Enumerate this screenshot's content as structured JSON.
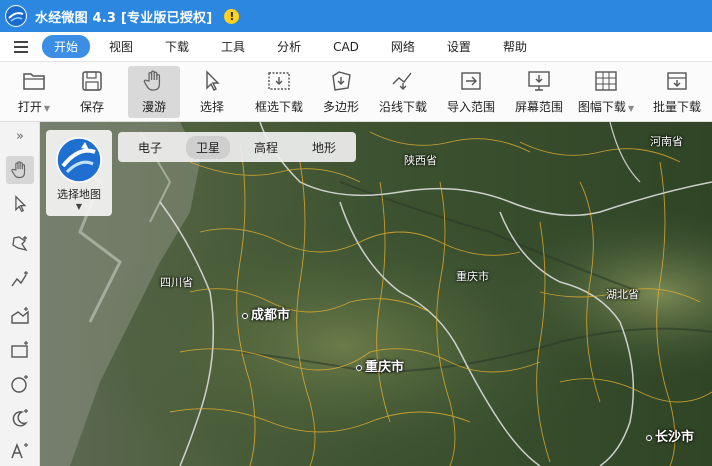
{
  "app": {
    "title": "水经微图 4.3 [专业版已授权]",
    "warning_symbol": "!"
  },
  "menu": {
    "items": [
      {
        "label": "开始",
        "active": true
      },
      {
        "label": "视图"
      },
      {
        "label": "下载"
      },
      {
        "label": "工具"
      },
      {
        "label": "分析"
      },
      {
        "label": "CAD"
      },
      {
        "label": "网络"
      },
      {
        "label": "设置"
      },
      {
        "label": "帮助"
      }
    ]
  },
  "toolbar": {
    "items": [
      {
        "label": "打开",
        "icon": "folder-icon",
        "has_dropdown": true
      },
      {
        "label": "保存",
        "icon": "floppy-icon"
      },
      {
        "label": "漫游",
        "icon": "hand-icon",
        "active": true
      },
      {
        "label": "选择",
        "icon": "cursor-icon"
      },
      {
        "label": "框选下载",
        "icon": "box-download-icon"
      },
      {
        "label": "多边形",
        "icon": "polygon-download-icon"
      },
      {
        "label": "沿线下载",
        "icon": "line-download-icon"
      },
      {
        "label": "导入范围",
        "icon": "import-range-icon"
      },
      {
        "label": "屏幕范围",
        "icon": "screen-range-icon"
      },
      {
        "label": "图幅下载",
        "icon": "sheet-download-icon",
        "has_dropdown": true
      },
      {
        "label": "批量下载",
        "icon": "batch-download-icon"
      }
    ]
  },
  "sidebar": {
    "collapse_glyph": "»",
    "tools": [
      "hand-icon",
      "cursor-icon",
      "pin-icon",
      "polyline-icon",
      "area-icon",
      "rectangle-icon",
      "circle-icon",
      "crescent-icon",
      "text-icon"
    ]
  },
  "map": {
    "selector_label": "选择地图",
    "tabs": [
      {
        "label": "电子"
      },
      {
        "label": "卫星",
        "active": true
      },
      {
        "label": "高程"
      },
      {
        "label": "地形"
      }
    ],
    "labels": {
      "shaanxi": "陕西省",
      "henan": "河南省",
      "sichuan": "四川省",
      "chongqing_region": "重庆市",
      "hubei": "湖北省",
      "chengdu": "成都市",
      "chongqing_city": "重庆市",
      "changsha": "长沙市"
    },
    "colors": {
      "accent": "#2c87e0",
      "boundary": "#e8b030",
      "province_border": "#e6e6e6"
    }
  }
}
